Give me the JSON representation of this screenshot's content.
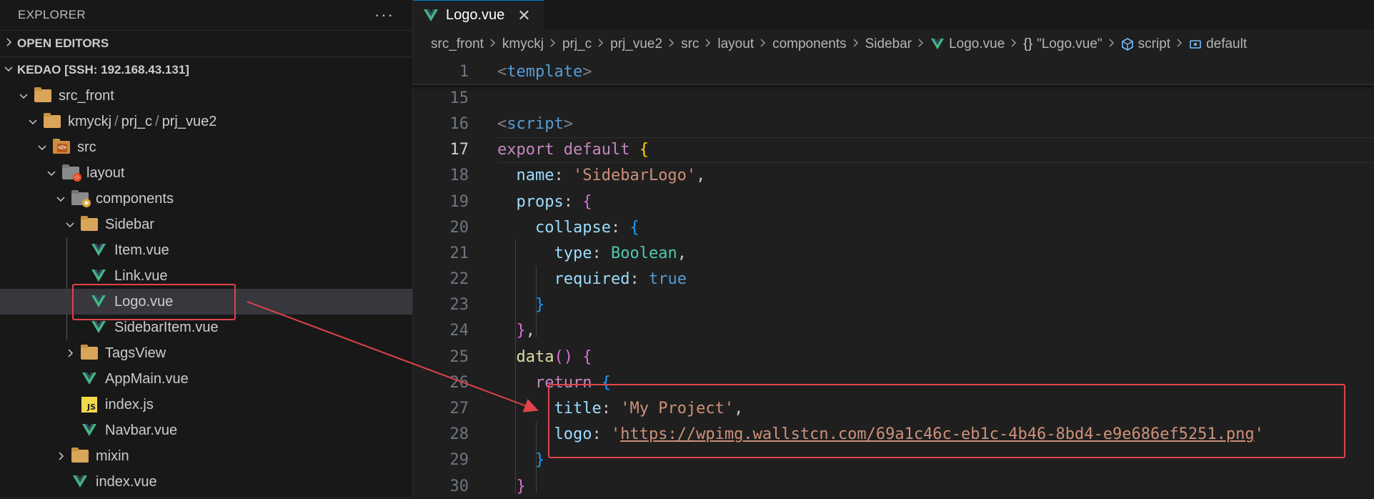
{
  "explorer": {
    "title": "EXPLORER",
    "more": "···",
    "open_editors": "OPEN EDITORS",
    "workspace": "KEDAO [SSH: 192.168.43.131]",
    "tree": {
      "src_front": "src_front",
      "path_a": "kmyckj",
      "path_b": "prj_c",
      "path_c": "prj_vue2",
      "path_sep": "/",
      "src": "src",
      "layout": "layout",
      "components": "components",
      "sidebar": "Sidebar",
      "item": "Item.vue",
      "link": "Link.vue",
      "logo": "Logo.vue",
      "sidebar_item": "SidebarItem.vue",
      "tags_view": "TagsView",
      "app_main": "AppMain.vue",
      "index_js": "index.js",
      "navbar": "Navbar.vue",
      "mixin": "mixin",
      "index_vue": "index.vue"
    }
  },
  "editor": {
    "tab_label": "Logo.vue",
    "tab_close": "✕",
    "breadcrumb": [
      "src_front",
      "kmyckj",
      "prj_c",
      "prj_vue2",
      "src",
      "layout",
      "components",
      "Sidebar",
      "Logo.vue",
      "\"Logo.vue\"",
      "script",
      "default"
    ],
    "breadcrumb_braces": "{}"
  },
  "code": {
    "l1": {
      "n": "1",
      "open": "<",
      "tag": "template",
      "close": ">"
    },
    "l15": {
      "n": "15"
    },
    "l16": {
      "n": "16",
      "open": "<",
      "tag": "script",
      "close": ">"
    },
    "l17": {
      "n": "17",
      "kw1": "export",
      "kw2": "default",
      "brace": "{"
    },
    "l18": {
      "n": "18",
      "prop": "name",
      "str": "'SidebarLogo'"
    },
    "l19": {
      "n": "19",
      "prop": "props",
      "brace": "{"
    },
    "l20": {
      "n": "20",
      "prop": "collapse",
      "brace": "{"
    },
    "l21": {
      "n": "21",
      "prop": "type",
      "val": "Boolean"
    },
    "l22": {
      "n": "22",
      "prop": "required",
      "val": "true"
    },
    "l23": {
      "n": "23",
      "brace": "}"
    },
    "l24": {
      "n": "24",
      "brace": "}"
    },
    "l25": {
      "n": "25",
      "fn": "data",
      "paren": "()",
      "brace": "{"
    },
    "l26": {
      "n": "26",
      "kw": "return",
      "brace": "{"
    },
    "l27": {
      "n": "27",
      "prop": "title",
      "str": "'My Project'"
    },
    "l28": {
      "n": "28",
      "prop": "logo",
      "url": "https://wpimg.wallstcn.com/69a1c46c-eb1c-4b46-8bd4-e9e686ef5251.png"
    },
    "l29": {
      "n": "29",
      "brace": "}"
    },
    "l30": {
      "n": "30",
      "brace": "}"
    }
  }
}
